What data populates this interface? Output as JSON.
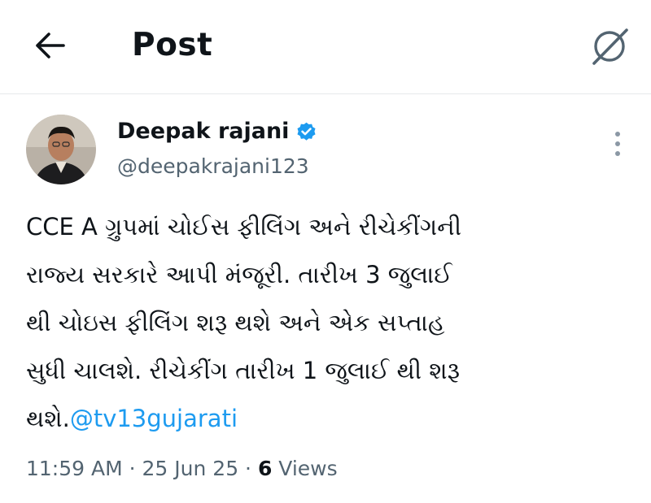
{
  "header": {
    "title": "Post",
    "back_icon": "arrow-left-icon",
    "grok_icon": "grok-icon"
  },
  "post": {
    "author": {
      "name": "Deepak rajani",
      "handle": "@deepakrajani123",
      "verified": true,
      "verified_color": "#1d9bf0"
    },
    "text_lines": [
      "CCE A ગ્રુપમાં ચોઈસ ફીલિંગ અને રીચેકીંગની",
      "રાજ્ય સરકારે આપી મંજૂરી. તારીખ 3 જુલાઈ",
      "થી ચોઇસ ફીલિંગ શરૂ થશે અને એક સપ્તાહ",
      "સુધી ચાલશે. રીચેકીંગ તારીખ 1 જુલાઈ થી શરૂ",
      "થશે."
    ],
    "mention": "@tv13gujarati",
    "meta": {
      "time": "11:59 AM",
      "sep1": " · ",
      "date": "25 Jun 25",
      "sep2": " · ",
      "views_count": "6",
      "views_label": " Views"
    }
  },
  "colors": {
    "accent": "#1d9bf0",
    "text_primary": "#0f1419",
    "text_secondary": "#536471",
    "divider": "#e6e9ec"
  }
}
